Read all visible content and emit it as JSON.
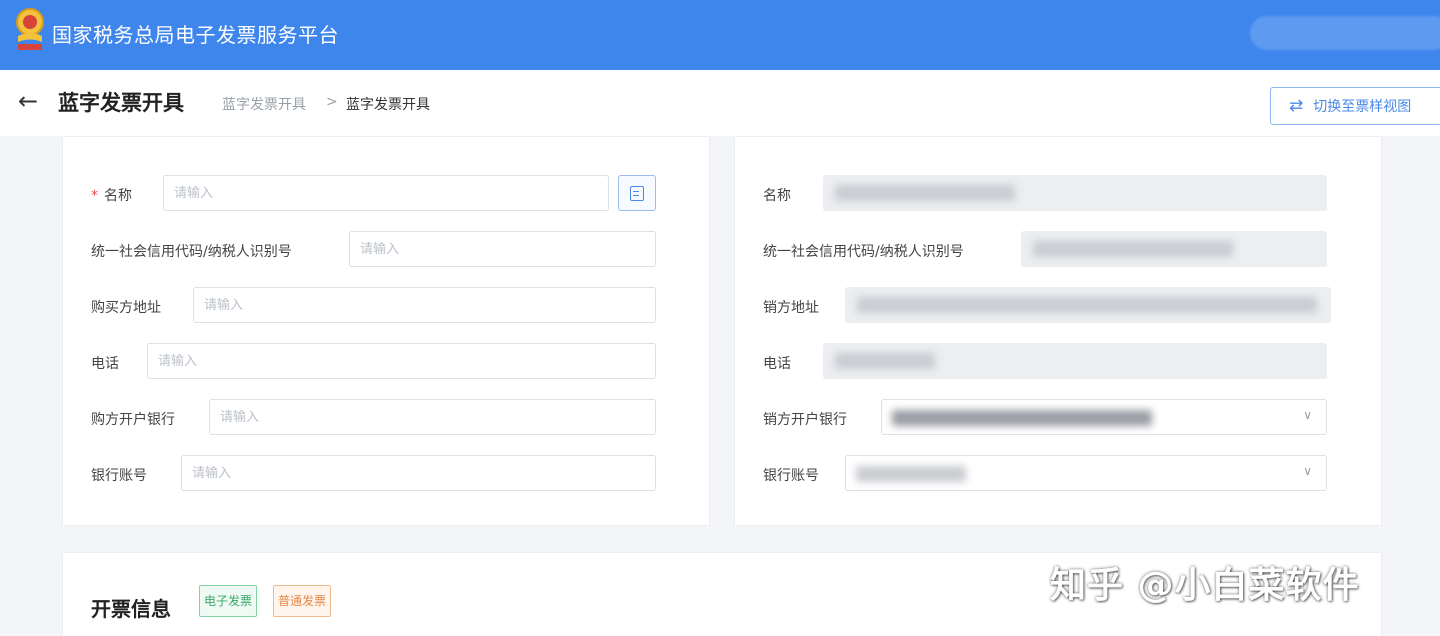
{
  "topbar": {
    "site_title": "国家税务总局电子发票服务平台",
    "brand_color": "#3f86ec"
  },
  "header": {
    "back_icon": "arrow-left-icon",
    "page_title": "蓝字发票开具",
    "breadcrumb": [
      "蓝字发票开具",
      ">",
      "蓝字发票开具"
    ],
    "switch_button_label": "切换至票样视图",
    "switch_icon": "swap-arrows-icon"
  },
  "buyer": {
    "fields": [
      {
        "label": "名称",
        "required": true,
        "placeholder": "请输入"
      },
      {
        "label": "统一社会信用代码/纳税人识别号",
        "required": false,
        "placeholder": "请输入"
      },
      {
        "label": "购买方地址",
        "required": false,
        "placeholder": "请输入"
      },
      {
        "label": "电话",
        "required": false,
        "placeholder": "请输入"
      },
      {
        "label": "购方开户银行",
        "required": false,
        "placeholder": "请输入"
      },
      {
        "label": "银行账号",
        "required": false,
        "placeholder": "请输入"
      }
    ],
    "pick_icon": "document-list-icon"
  },
  "seller": {
    "fields": [
      {
        "label": "名称"
      },
      {
        "label": "统一社会信用代码/纳税人识别号"
      },
      {
        "label": "销方地址"
      },
      {
        "label": "电话"
      },
      {
        "label": "销方开户银行"
      },
      {
        "label": "银行账号"
      }
    ],
    "dropdown_icon": "chevron-down-icon"
  },
  "invoice_info": {
    "title": "开票信息",
    "tags": [
      "电子发票",
      "普通发票"
    ],
    "tag_colors": {
      "green": "#3aa86a",
      "orange": "#e5894a"
    }
  },
  "watermark": "知乎 @小白菜软件"
}
